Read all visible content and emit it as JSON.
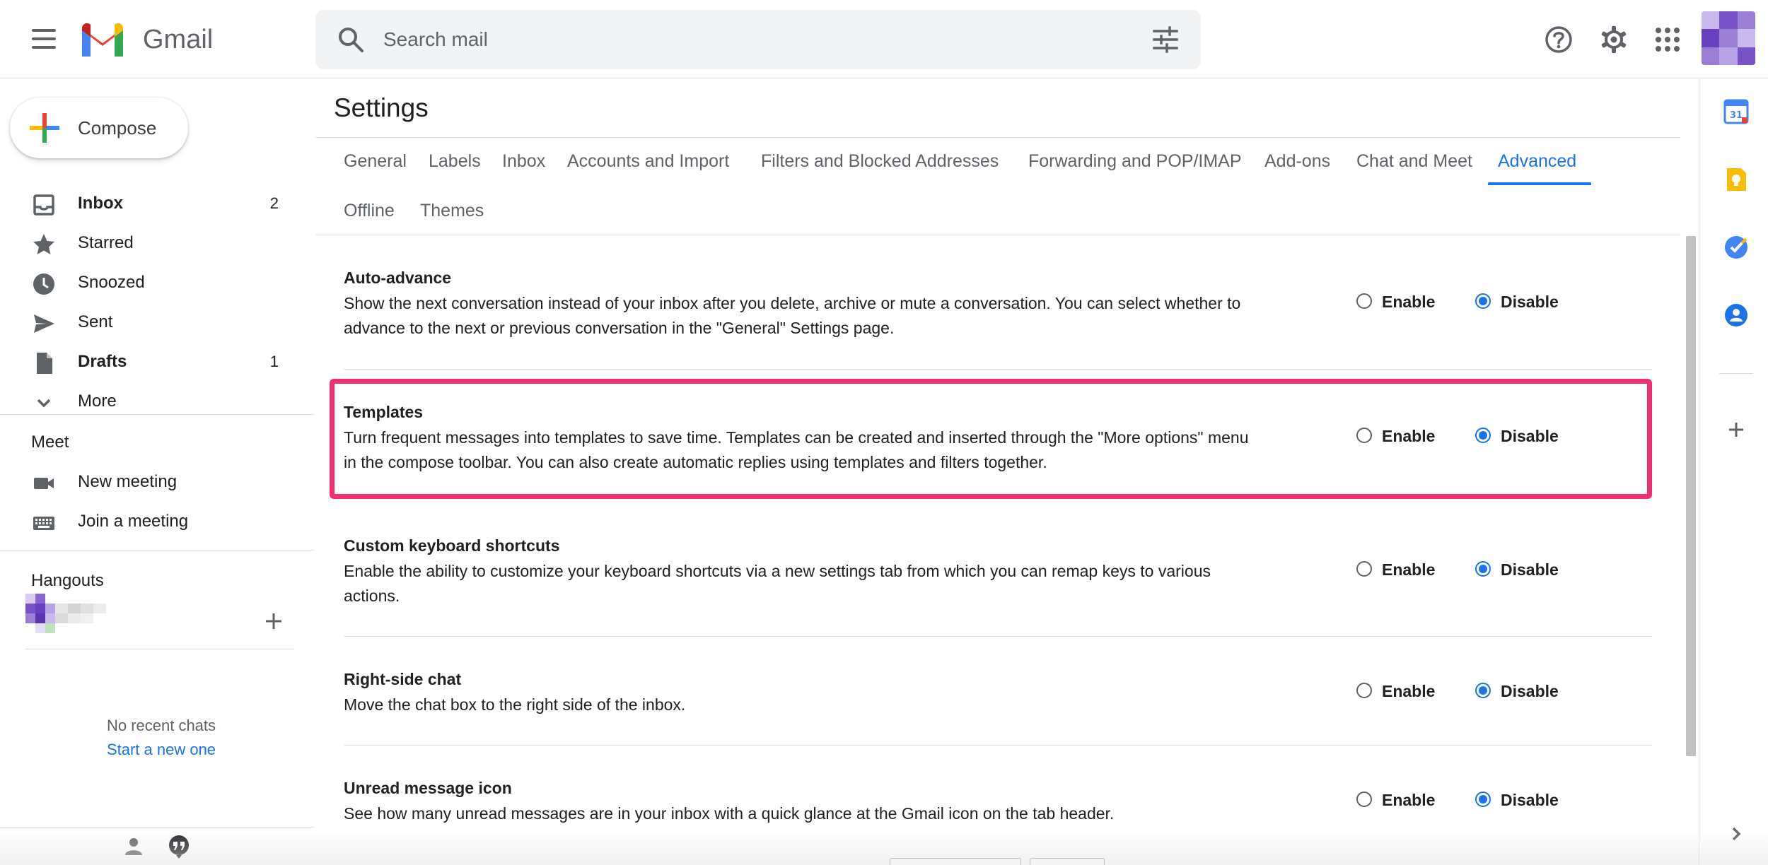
{
  "app": {
    "name": "Gmail"
  },
  "search": {
    "placeholder": "Search mail"
  },
  "compose": {
    "label": "Compose"
  },
  "nav": [
    {
      "label": "Inbox",
      "count": "2",
      "bold": true
    },
    {
      "label": "Starred",
      "count": ""
    },
    {
      "label": "Snoozed",
      "count": ""
    },
    {
      "label": "Sent",
      "count": ""
    },
    {
      "label": "Drafts",
      "count": "1",
      "bold": true
    },
    {
      "label": "More",
      "count": ""
    }
  ],
  "meet": {
    "title": "Meet",
    "new_meeting": "New meeting",
    "join": "Join a meeting"
  },
  "hangouts": {
    "title": "Hangouts",
    "no_chats": "No recent chats",
    "start_new": "Start a new one"
  },
  "settings": {
    "title": "Settings",
    "tabs": [
      "General",
      "Labels",
      "Inbox",
      "Accounts and Import",
      "Filters and Blocked Addresses",
      "Forwarding and POP/IMAP",
      "Add-ons",
      "Chat and Meet",
      "Advanced",
      "Offline",
      "Themes"
    ],
    "active_tab": "Advanced",
    "enable_label": "Enable",
    "disable_label": "Disable",
    "items": [
      {
        "name": "Auto-advance",
        "desc": "Show the next conversation instead of your inbox after you delete, archive or mute a conversation. You can select whether to advance to the next or previous conversation in the \"General\" Settings page.",
        "value": "Disable"
      },
      {
        "name": "Templates",
        "desc": "Turn frequent messages into templates to save time. Templates can be created and inserted through the \"More options\" menu in the compose toolbar. You can also create automatic replies using templates and filters together.",
        "value": "Disable",
        "highlighted": true
      },
      {
        "name": "Custom keyboard shortcuts",
        "desc": "Enable the ability to customize your keyboard shortcuts via a new settings tab from which you can remap keys to various actions.",
        "value": "Disable"
      },
      {
        "name": "Right-side chat",
        "desc": "Move the chat box to the right side of the inbox.",
        "value": "Disable"
      },
      {
        "name": "Unread message icon",
        "desc": "See how many unread messages are in your inbox with a quick glance at the Gmail icon on the tab header.",
        "value": "Disable"
      }
    ]
  },
  "right_panel": {
    "calendar_day": "31"
  },
  "colors": {
    "accent": "#1a73e8",
    "highlight": "#f2306e"
  }
}
